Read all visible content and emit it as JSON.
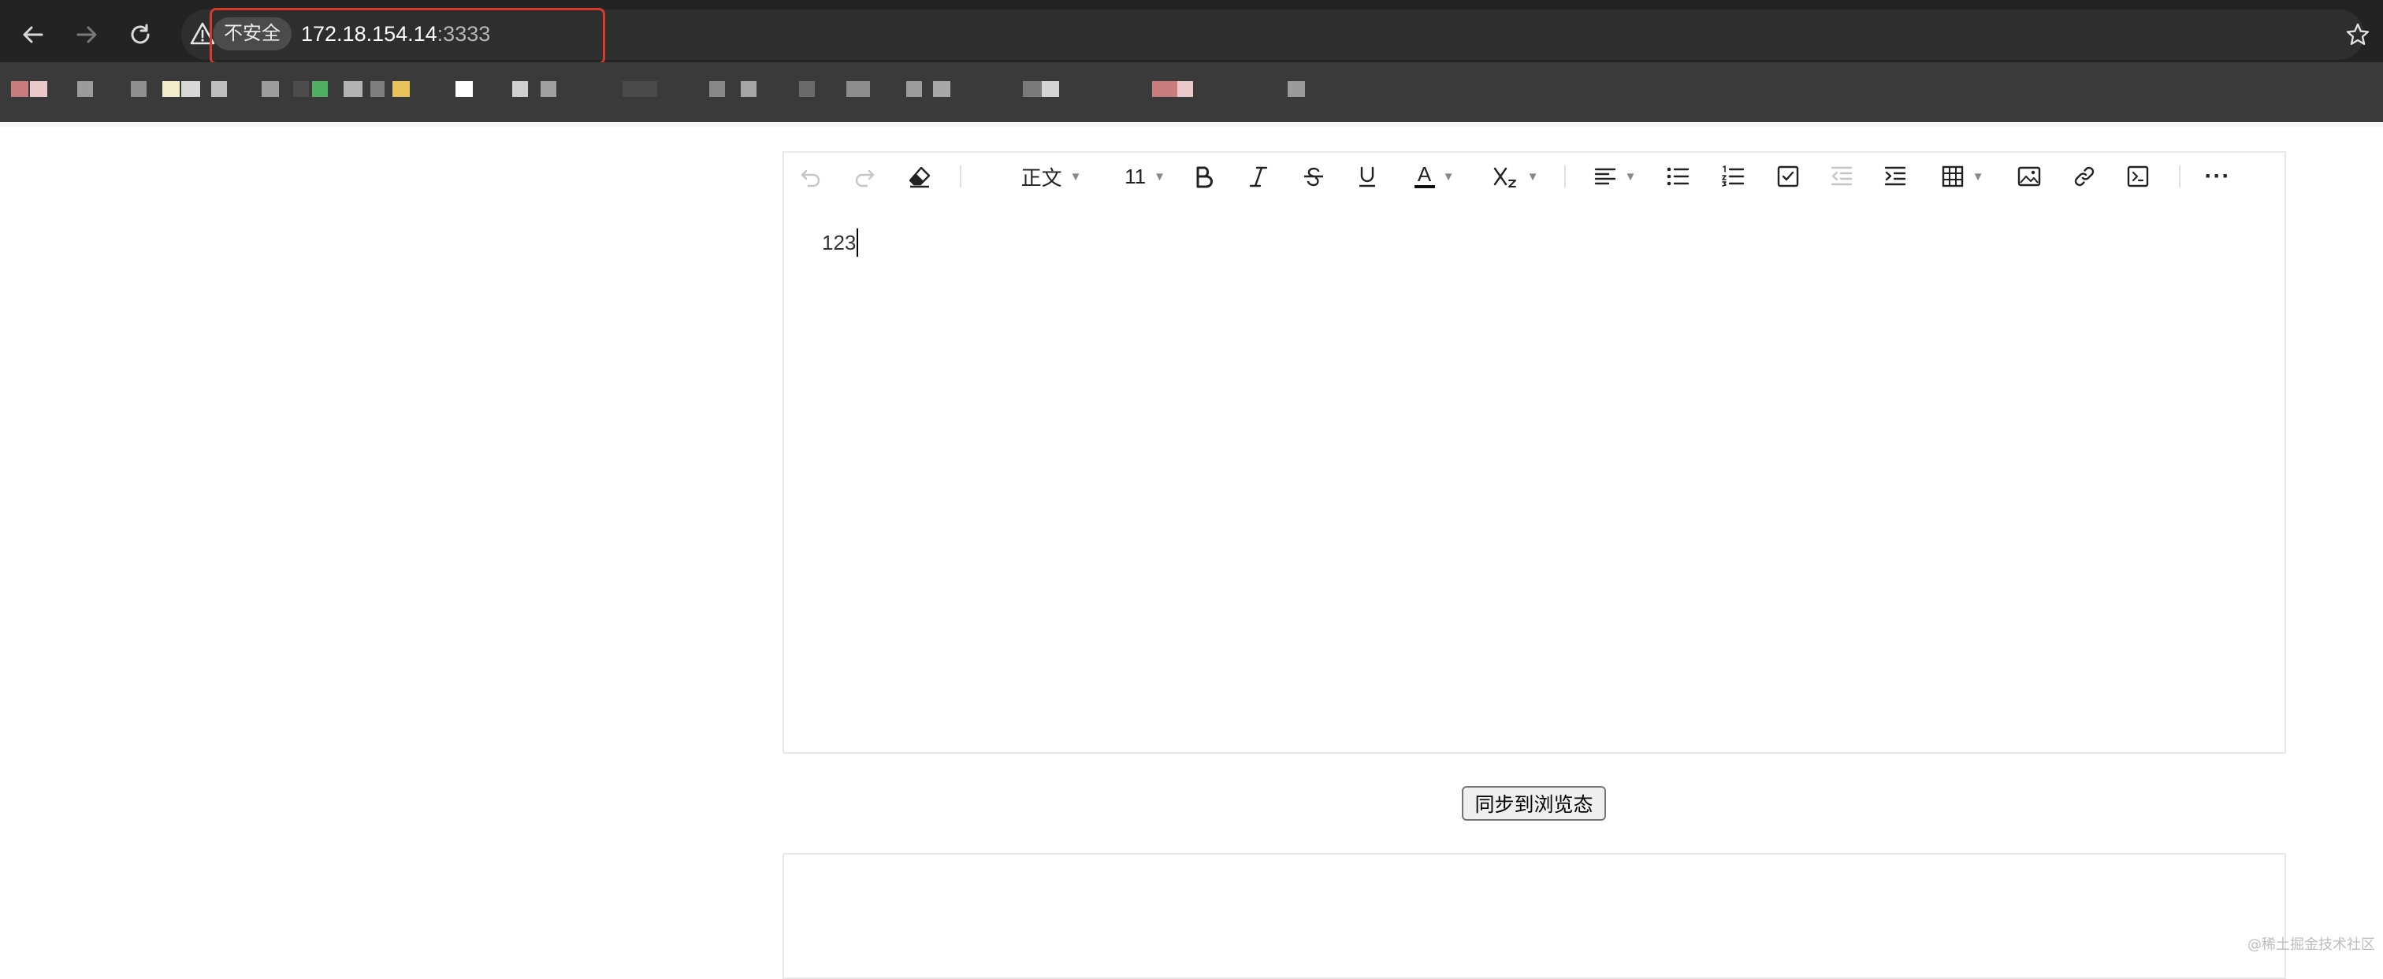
{
  "browser": {
    "security_chip": "不安全",
    "url_host": "172.18.154.14",
    "url_port": ":3333",
    "bookmark_colors": [
      "#c87c7c",
      "#e9c9c9",
      "#9b9b9b",
      "#8f8f8f",
      "#f4edc9",
      "#d8d8d8",
      "#bdbdbd",
      "#9c9c9c",
      "#4c4c4c",
      "#4fae5f",
      "#b3b3b3",
      "#7f7f7f",
      "#e8c35a",
      "#ffffff",
      "#d0d0d0",
      "#9f9f9f",
      "#4a4a4a",
      "#888888",
      "#a5a5a5",
      "#6a6a6a",
      "#8d8d8d",
      "#9c9c9c",
      "#a8a8a8",
      "#7a7a7a",
      "#d4d4d4"
    ]
  },
  "toolbar": {
    "icons": [
      "undo-icon",
      "redo-icon",
      "eraser-icon",
      "bold-icon",
      "italic-icon",
      "strikethrough-icon",
      "underline-icon",
      "font-color-icon",
      "subscript-icon",
      "align-icon",
      "bulleted-list-icon",
      "numbered-list-icon",
      "todo-checkbox-icon",
      "outdent-icon",
      "indent-icon",
      "table-icon",
      "image-icon",
      "link-icon",
      "code-block-icon",
      "more-icon"
    ],
    "paragraph_style": "正文",
    "font_size": "11",
    "font_color_letter": "A",
    "more_label": "···"
  },
  "editor": {
    "content": "123"
  },
  "sync_button": "同步到浏览态",
  "watermark": "@稀土掘金技术社区"
}
